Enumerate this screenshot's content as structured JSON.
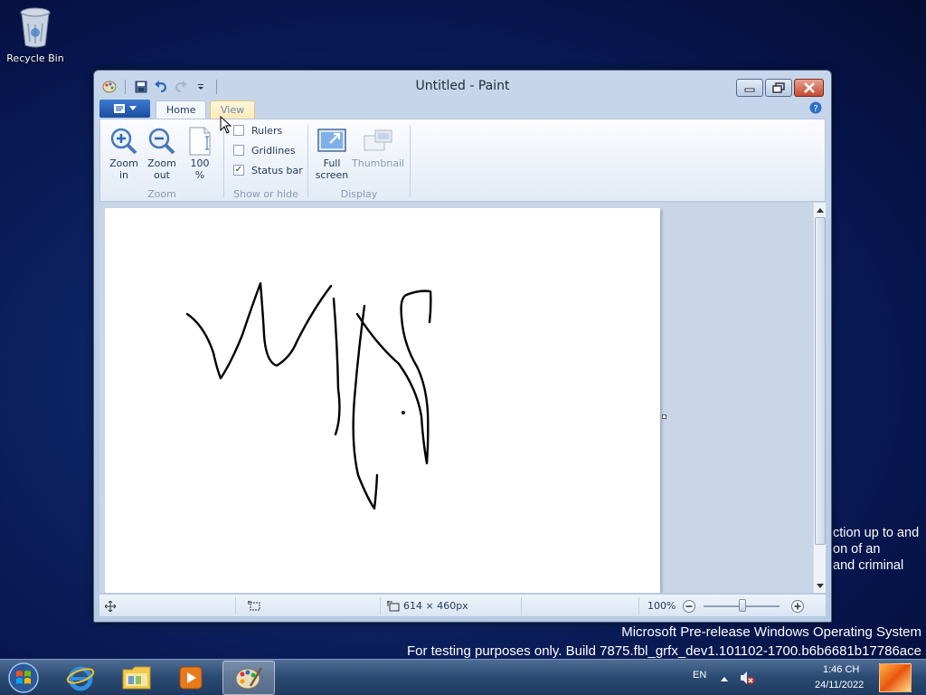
{
  "desktop": {
    "recycle_bin_label": "Recycle Bin",
    "background_fragment_right": [
      "ction up to and",
      "on of an",
      "and criminal"
    ],
    "watermark_line1": "Microsoft Pre-release Windows Operating System",
    "watermark_line2": "For testing purposes only. Build 7875.fbl_grfx_dev1.101102-1700.b6b6681b17786ace"
  },
  "window": {
    "title": "Untitled - Paint"
  },
  "ribbon": {
    "tabs": [
      {
        "label": "Home",
        "selected": false
      },
      {
        "label": "View",
        "selected": true
      }
    ],
    "groups": {
      "zoom": {
        "label": "Zoom",
        "buttons": [
          {
            "label_line1": "Zoom",
            "label_line2": "in",
            "icon": "zoom-in-icon"
          },
          {
            "label_line1": "Zoom",
            "label_line2": "out",
            "icon": "zoom-out-icon"
          },
          {
            "label_line1": "100",
            "label_line2": "%",
            "icon": "page-100-icon"
          }
        ]
      },
      "show_or_hide": {
        "label": "Show or hide",
        "options": [
          {
            "label": "Rulers",
            "checked": false
          },
          {
            "label": "Gridlines",
            "checked": false
          },
          {
            "label": "Status bar",
            "checked": true
          }
        ]
      },
      "display": {
        "label": "Display",
        "buttons": [
          {
            "label_line1": "Full",
            "label_line2": "screen",
            "icon": "fullscreen-icon",
            "enabled": true
          },
          {
            "label_line1": "Thumbnail",
            "label_line2": "",
            "icon": "thumbnail-icon",
            "enabled": false
          }
        ]
      }
    }
  },
  "statusbar": {
    "image_size": "614 × 460px",
    "zoom_level": "100%",
    "zoom_fraction": 0.5
  },
  "taskbar": {
    "language": "EN",
    "time": "1:46 CH",
    "date": "24/11/2022",
    "apps": [
      "internet-explorer",
      "windows-explorer",
      "media-player",
      "paint"
    ],
    "active_app": "paint"
  },
  "colors": {
    "accent": "#1b4e9e",
    "window_frame": "#b7cbe3",
    "canvas": "#ffffff",
    "desktop": "#0c2260"
  }
}
